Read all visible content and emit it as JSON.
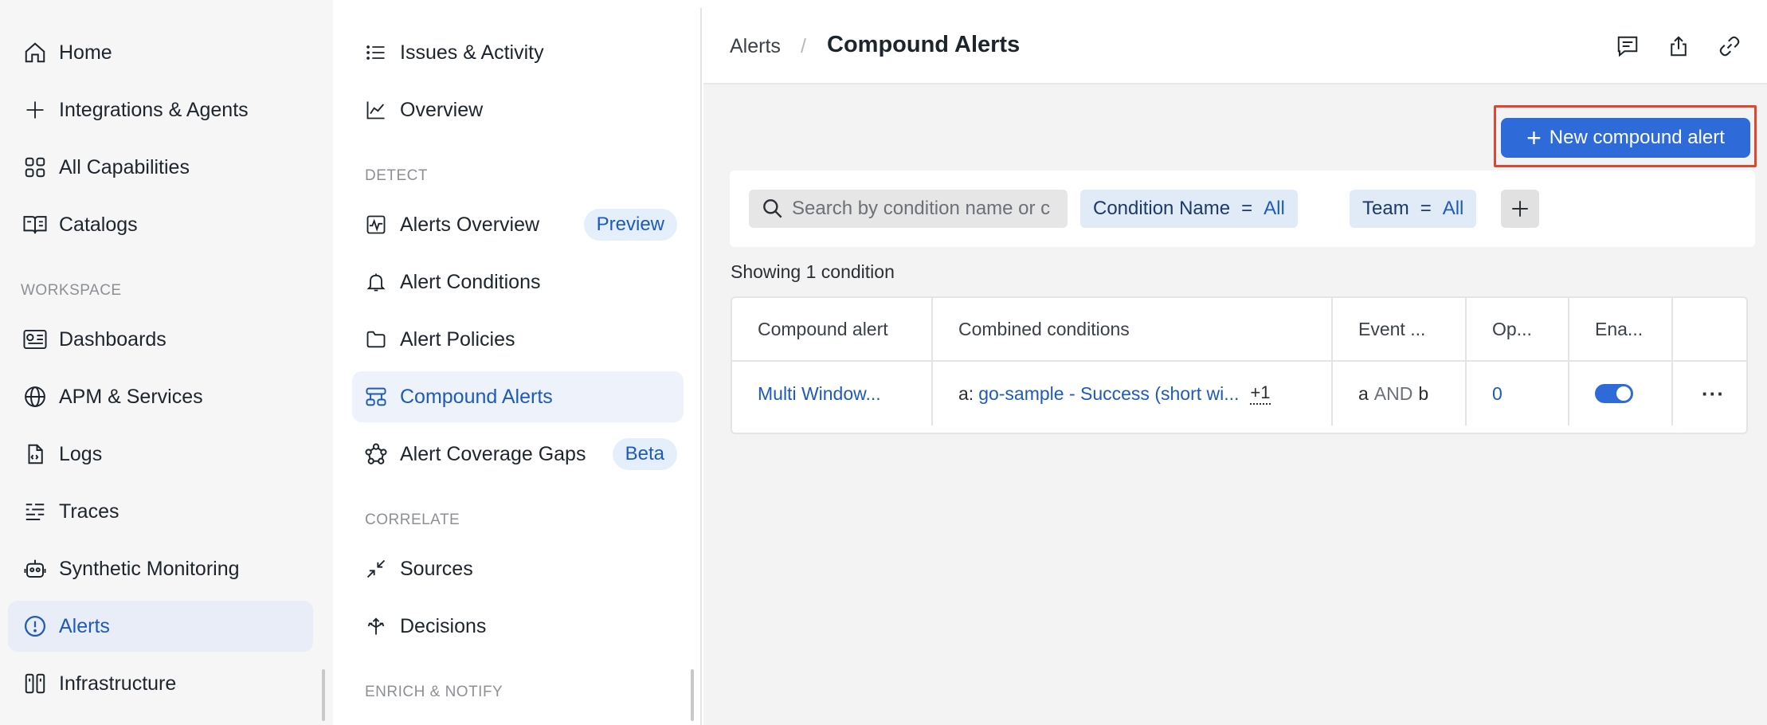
{
  "primary_nav": {
    "items": [
      {
        "label": "Home",
        "icon": "home-icon"
      },
      {
        "label": "Integrations & Agents",
        "icon": "plus-icon"
      },
      {
        "label": "All Capabilities",
        "icon": "grid-icon"
      },
      {
        "label": "Catalogs",
        "icon": "book-icon"
      },
      {
        "label": "Dashboards",
        "icon": "dashboard-icon"
      },
      {
        "label": "APM & Services",
        "icon": "globe-icon"
      },
      {
        "label": "Logs",
        "icon": "logs-icon"
      },
      {
        "label": "Traces",
        "icon": "traces-icon"
      },
      {
        "label": "Synthetic Monitoring",
        "icon": "robot-icon"
      },
      {
        "label": "Alerts",
        "icon": "alert-circle-icon",
        "active": true
      },
      {
        "label": "Infrastructure",
        "icon": "infrastructure-icon"
      }
    ],
    "workspace_section": "WORKSPACE"
  },
  "secondary_nav": {
    "items": [
      {
        "label": "Issues & Activity",
        "icon": "list-icon"
      },
      {
        "label": "Overview",
        "icon": "chart-line-icon"
      },
      {
        "label": "Alerts Overview",
        "icon": "pulse-icon",
        "badge": "Preview"
      },
      {
        "label": "Alert Conditions",
        "icon": "bell-icon"
      },
      {
        "label": "Alert Policies",
        "icon": "folder-icon"
      },
      {
        "label": "Compound Alerts",
        "icon": "compound-icon",
        "active": true
      },
      {
        "label": "Alert Coverage Gaps",
        "icon": "coverage-icon",
        "badge": "Beta"
      },
      {
        "label": "Sources",
        "icon": "collapse-arrows-icon"
      },
      {
        "label": "Decisions",
        "icon": "decisions-icon"
      }
    ],
    "sections": {
      "detect": "DETECT",
      "correlate": "CORRELATE",
      "enrich": "ENRICH & NOTIFY"
    }
  },
  "header": {
    "breadcrumb_parent": "Alerts",
    "breadcrumb_sep": "/",
    "title": "Compound Alerts",
    "icons": [
      "feedback-icon",
      "share-icon",
      "link-icon"
    ]
  },
  "actions": {
    "new_button": "New compound alert"
  },
  "filters": {
    "search_placeholder": "Search by condition name or c",
    "chips": [
      {
        "field": "Condition Name",
        "op": "=",
        "value": "All"
      },
      {
        "field": "Team",
        "op": "=",
        "value": "All"
      }
    ]
  },
  "results": {
    "showing": "Showing 1 condition"
  },
  "table": {
    "columns": [
      "Compound alert",
      "Combined conditions",
      "Event ...",
      "Op...",
      "Ena..."
    ],
    "rows": [
      {
        "name": "Multi Window...",
        "condition_prefix": "a:",
        "condition_link": "go-sample - Success (short wi...",
        "more": "+1",
        "event_a": "a",
        "event_and": "AND",
        "event_b": "b",
        "open": "0",
        "enabled": true
      }
    ]
  },
  "colors": {
    "accent": "#2f6bd8",
    "link": "#1e5bb8",
    "highlight_border": "#e2452f"
  }
}
